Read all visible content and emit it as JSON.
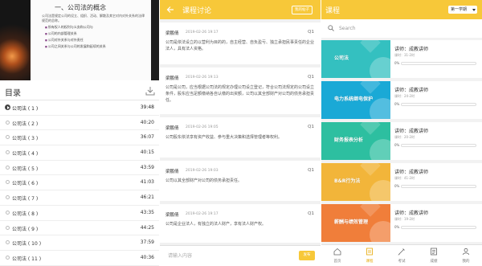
{
  "player": {
    "slide_title": "一、公司法的概念",
    "slide_paragraph": "公司法是规定公司的设立、组织、活动、解散及其它对内对外关系的法律规范的总称。",
    "slide_bullets": [
      "所有权人的权利与义务和公司与",
      "公司的内部管理关系",
      "公司对外关系与对外责任",
      "公司之间关系与公司的发展和延续的关系"
    ]
  },
  "toc": {
    "title": "目录",
    "download_icon": "download-icon",
    "items": [
      {
        "name": "公司法 ( 1 )",
        "duration": "39:48",
        "active": true
      },
      {
        "name": "公司法 ( 2 )",
        "duration": "40:20",
        "active": false
      },
      {
        "name": "公司法 ( 3 )",
        "duration": "36:07",
        "active": false
      },
      {
        "name": "公司法 ( 4 )",
        "duration": "40:15",
        "active": false
      },
      {
        "name": "公司法 ( 5 )",
        "duration": "43:59",
        "active": false
      },
      {
        "name": "公司法 ( 6 )",
        "duration": "41:03",
        "active": false
      },
      {
        "name": "公司法 ( 7 )",
        "duration": "46:21",
        "active": false
      },
      {
        "name": "公司法 ( 8 )",
        "duration": "43:35",
        "active": false
      },
      {
        "name": "公司法 ( 9 )",
        "duration": "44:25",
        "active": false
      },
      {
        "name": "公司法 ( 10 )",
        "duration": "37:59",
        "active": false
      },
      {
        "name": "公司法 ( 11 )",
        "duration": "40:36",
        "active": false
      }
    ]
  },
  "discussion": {
    "title": "课程讨论",
    "my_button": "我的帖子",
    "comments": [
      {
        "user": "梁鹏倩",
        "time": "2019-02-26 19:17",
        "floor": "Q1",
        "text": "公司是依法设立的以营利为目的的，自主经营、自负盈亏、独立承担民事责任的企业法人，具有法人资格。"
      },
      {
        "user": "梁鹏倩",
        "time": "2019-02-26 19:13",
        "floor": "Q1",
        "text": "公司是公司，应当根据公司法的规定办理公司设立登记，符合公司法规定的公司设立条件，股东应当足额缴纳各自认缴的出资额，公司以其全部财产对公司的债务承担责任。"
      },
      {
        "user": "梁鹏倩",
        "time": "2019-02-26 19:05",
        "floor": "Q1",
        "text": "公司股东依法享有资产收益、参与重大决策和选择管理者等权利。"
      },
      {
        "user": "梁鹏倩",
        "time": "2019-02-26 19:03",
        "floor": "Q1",
        "text": "公司以其全部财产对公司的债务承担责任。"
      },
      {
        "user": "梁鹏倩",
        "time": "2019-02-26 19:17",
        "floor": "Q1",
        "text": "公司是企业法人，有独立的法人财产，享有法人财产权。"
      }
    ],
    "input_placeholder": "请输入内容",
    "send_label": "发布"
  },
  "courses_page": {
    "title": "课程",
    "term": "第一学期",
    "search_placeholder": "Search",
    "courses": [
      {
        "name": "公司法",
        "teacher": "讲师：成教讲师",
        "class_time": "课时：31-2时",
        "progress": 0,
        "progress_text": "0%",
        "color": "#34c0c0"
      },
      {
        "name": "电力系统继电保护",
        "teacher": "讲师：成教讲师",
        "class_time": "课时：24-2时",
        "progress": 0,
        "progress_text": "0%",
        "color": "#1aa9d6"
      },
      {
        "name": "财务报表分析",
        "teacher": "讲师：成教讲师",
        "class_time": "课时：20-2时",
        "progress": 0,
        "progress_text": "0%",
        "color": "#2dbfa0"
      },
      {
        "name": "B&R行为法",
        "teacher": "讲师：成教讲师",
        "class_time": "课时：41-2时",
        "progress": 0,
        "progress_text": "0%",
        "color": "#f2b53a"
      },
      {
        "name": "薪酬与绩效管理",
        "teacher": "讲师：成教讲师",
        "class_time": "课时：19-2时",
        "progress": 0,
        "progress_text": "0%",
        "color": "#f07e3a"
      }
    ],
    "tabs": [
      {
        "label": "首页",
        "icon": "home-icon",
        "active": false
      },
      {
        "label": "课程",
        "icon": "course-icon",
        "active": true
      },
      {
        "label": "考试",
        "icon": "exam-icon",
        "active": false
      },
      {
        "label": "成绩",
        "icon": "grade-icon",
        "active": false
      },
      {
        "label": "我的",
        "icon": "profile-icon",
        "active": false
      }
    ]
  }
}
